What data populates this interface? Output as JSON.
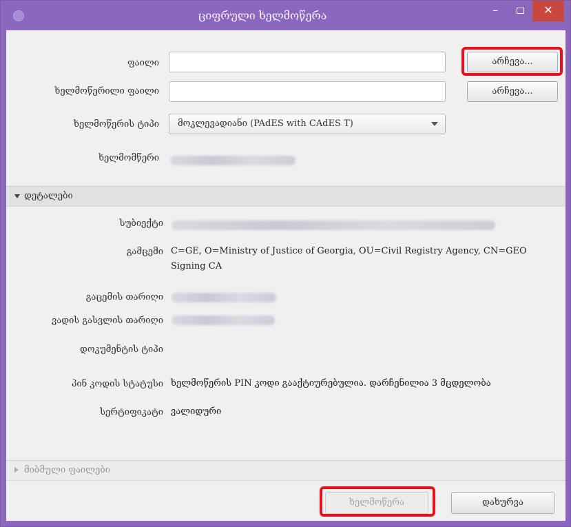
{
  "window": {
    "title": "ციფრული ხელმოწერა"
  },
  "form": {
    "file_label": "ფაილი",
    "file_value": "",
    "signed_file_label": "ხელმოწერილი ფაილი",
    "signed_file_value": "",
    "choose_label": "არჩევა...",
    "signature_type_label": "ხელმოწერის ტიპი",
    "signature_type_value": "მოკლევადიანი (PAdES with CAdES T)",
    "signer_label": "ხელმომწერი"
  },
  "details": {
    "header": "დეტალები",
    "subject_label": "სუბიექტი",
    "issuer_label": "გამცემი",
    "issuer_value": "C=GE, O=Ministry of Justice of Georgia, OU=Civil Registry Agency, CN=GEO Signing CA",
    "issue_date_label": "გაცემის თარიღი",
    "expiry_date_label": "ვადის გასვლის თარიღი",
    "document_type_label": "დოკუმენტის ტიპი",
    "pin_status_label": "პინ კოდის სტატუსი",
    "pin_status_value": "ხელმოწერის PIN კოდი გააქტიურებულია. დარჩენილია 3 მცდელობა",
    "certificate_label": "სერტიფიკატი",
    "certificate_value": "ვალიდური"
  },
  "attached": {
    "header": "მიბმული ფაილები"
  },
  "footer": {
    "sign_label": "ხელმოწერა",
    "close_label": "დახურვა"
  },
  "colors": {
    "titlebar": "#8C67BE",
    "close": "#c9473c",
    "highlight": "#e8101e"
  }
}
